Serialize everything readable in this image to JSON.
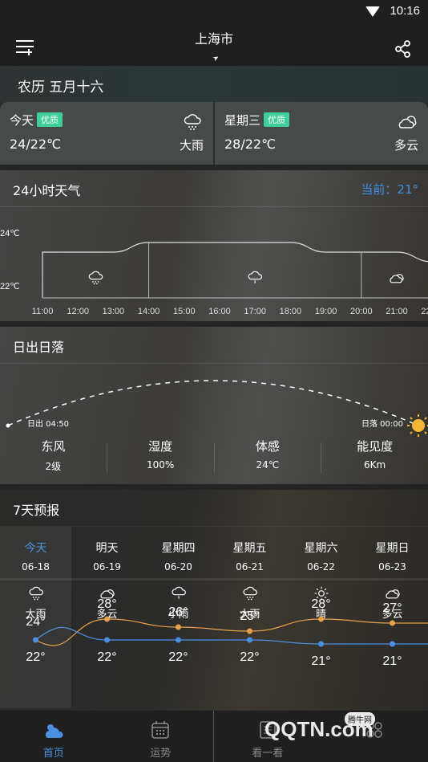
{
  "status_bar": {
    "time": "10:16",
    "wifi_icon": "wifi-icon"
  },
  "header": {
    "city": "上海市",
    "menu_icon": "menu-add-icon",
    "location_icon": "location-arrow-icon",
    "share_icon": "share-icon"
  },
  "lunar_date": "农历 五月十六",
  "day_cards": [
    {
      "day": "今天",
      "aqi": "优质",
      "temp": "24/22℃",
      "condition": "大雨",
      "icon": "heavy-rain-icon"
    },
    {
      "day": "星期三",
      "aqi": "优质",
      "temp": "28/22℃",
      "condition": "多云",
      "icon": "cloudy-icon"
    }
  ],
  "hourly": {
    "title": "24小时天气",
    "current": "当前：21°",
    "y_labels": [
      "24℃",
      "22℃"
    ],
    "times": [
      "11:00",
      "12:00",
      "13:00",
      "14:00",
      "15:00",
      "16:00",
      "17:00",
      "18:00",
      "19:00",
      "20:00",
      "21:00",
      "22:00"
    ],
    "temps": [
      23,
      23,
      23,
      24,
      24,
      24,
      24,
      24,
      23,
      23,
      23,
      22
    ],
    "segments": [
      {
        "from": "11:00",
        "to": "14:00",
        "icon": "heavy-rain-icon"
      },
      {
        "from": "14:00",
        "to": "20:00",
        "icon": "light-rain-icon"
      },
      {
        "from": "20:00",
        "to": "22:00",
        "icon": "cloudy-icon"
      }
    ]
  },
  "sun": {
    "title": "日出日落",
    "sunrise": "日出 04:50",
    "sunset": "日落 00:00",
    "stats": [
      {
        "label": "东风",
        "value": "2级"
      },
      {
        "label": "湿度",
        "value": "100%"
      },
      {
        "label": "体感",
        "value": "24℃"
      },
      {
        "label": "能见度",
        "value": "6Km"
      }
    ]
  },
  "forecast": {
    "title": "7天预报",
    "days": [
      {
        "name": "今天",
        "date": "06-18",
        "condition": "大雨",
        "icon": "heavy-rain-icon",
        "high": "24°",
        "low": "22°",
        "hi": 24,
        "lo": 22
      },
      {
        "name": "明天",
        "date": "06-19",
        "condition": "多云",
        "icon": "cloudy-icon",
        "high": "28°",
        "low": "22°",
        "hi": 28,
        "lo": 22
      },
      {
        "name": "星期四",
        "date": "06-20",
        "condition": "小雨",
        "icon": "light-rain-icon",
        "high": "26°",
        "low": "22°",
        "hi": 26,
        "lo": 22
      },
      {
        "name": "星期五",
        "date": "06-21",
        "condition": "大雨",
        "icon": "heavy-rain-icon",
        "high": "25°",
        "low": "22°",
        "hi": 25,
        "lo": 22
      },
      {
        "name": "星期六",
        "date": "06-22",
        "condition": "晴",
        "icon": "sunny-icon",
        "high": "28°",
        "low": "21°",
        "hi": 28,
        "lo": 21
      },
      {
        "name": "星期日",
        "date": "06-23",
        "condition": "多云",
        "icon": "cloudy-icon",
        "high": "27°",
        "low": "21°",
        "hi": 27,
        "lo": 21
      }
    ],
    "colors": {
      "high": "#e8a04a",
      "low": "#4a90e2"
    }
  },
  "tabs": [
    {
      "label": "首页",
      "icon": "weather-home-icon",
      "active": true
    },
    {
      "label": "运势",
      "icon": "calendar-icon",
      "active": false
    },
    {
      "label": "看一看",
      "icon": "news-icon",
      "active": false
    },
    {
      "label": "",
      "icon": "apps-icon",
      "active": false
    }
  ],
  "watermark": {
    "text": "QQTN.com",
    "badge": "腾牛网"
  }
}
